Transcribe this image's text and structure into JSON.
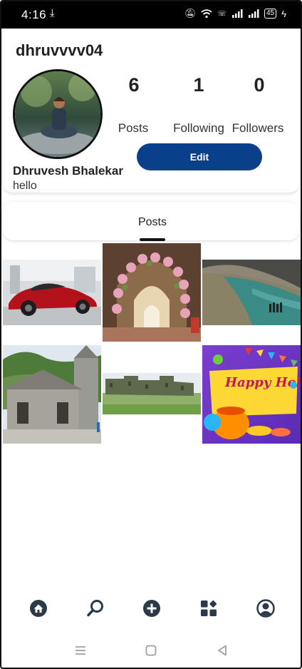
{
  "status_bar": {
    "time": "4:16",
    "battery": "45"
  },
  "profile": {
    "username": "dhruvvvv04",
    "full_name": "Dhruvesh Bhalekar",
    "bio": "hello",
    "stats": [
      {
        "count": "6",
        "label": "Posts"
      },
      {
        "count": "1",
        "label": "Following"
      },
      {
        "count": "0",
        "label": "Followers"
      }
    ],
    "edit_label": "Edit"
  },
  "tabs": {
    "posts_label": "Posts"
  },
  "posts": [
    {
      "subject": "red sports car in showroom"
    },
    {
      "subject": "flower decorated corridor"
    },
    {
      "subject": "river with rocks"
    },
    {
      "subject": "stone temple with mountains"
    },
    {
      "subject": "hill fort landscape"
    },
    {
      "subject": "Happy Holi greeting",
      "text": "Happy Holi!"
    }
  ],
  "bottom_nav": [
    "home-icon",
    "search-icon",
    "add-icon",
    "dashboard-icon",
    "profile-icon"
  ],
  "colors": {
    "accent": "#0a3f8a",
    "nav_icon": "#2b3a4a"
  }
}
